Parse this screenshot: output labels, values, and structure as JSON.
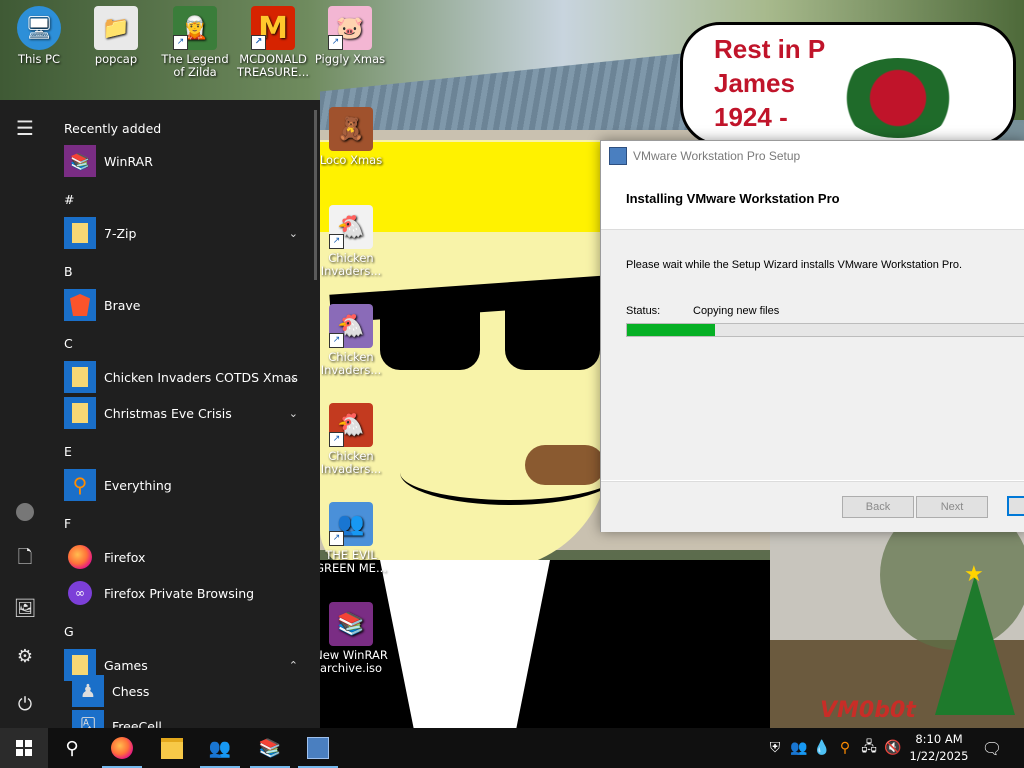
{
  "desktop_icons": [
    {
      "label": "This PC",
      "icon": "computer-icon"
    },
    {
      "label": "popcap",
      "icon": "folder-icon"
    },
    {
      "label": "The Legend of Zilda",
      "icon": "game-icon"
    },
    {
      "label": "MCDONALD TREASURE...",
      "icon": "mcdonalds-icon"
    },
    {
      "label": "Piggly Xmas",
      "icon": "pig-icon"
    },
    {
      "label": "Loco Xmas",
      "icon": "bear-icon"
    },
    {
      "label": "Chicken Invaders...",
      "icon": "chicken-icon"
    },
    {
      "label": "Chicken Invaders...",
      "icon": "chicken-icon"
    },
    {
      "label": "Chicken Invaders...",
      "icon": "chicken-icon"
    },
    {
      "label": "THE EVIL GREEN ME...",
      "icon": "people-icon"
    },
    {
      "label": "New WinRAR archive.iso",
      "icon": "winrar-icon"
    }
  ],
  "wallpaper_sign": {
    "line1": "Rest in P",
    "line2": "James",
    "line3": "1924 -"
  },
  "watermark": "VM0b0t",
  "start_menu": {
    "recently_added_header": "Recently added",
    "sections": {
      "hash": "#",
      "b": "B",
      "c": "C",
      "e": "E",
      "f": "F",
      "g": "G"
    },
    "apps": {
      "winrar": "WinRAR",
      "sevenzip": "7-Zip",
      "brave": "Brave",
      "chicken": "Chicken Invaders COTDS Xmas",
      "christmas": "Christmas Eve Crisis",
      "everything": "Everything",
      "firefox": "Firefox",
      "firefox_private": "Firefox Private Browsing",
      "games": "Games",
      "chess": "Chess",
      "freecell": "FreeCell"
    }
  },
  "installer": {
    "window_title": "VMware Workstation Pro Setup",
    "heading": "Installing VMware Workstation Pro",
    "description": "Please wait while the Setup Wizard installs VMware Workstation Pro.",
    "status_label": "Status:",
    "status_value": "Copying new files",
    "progress_percent": 22,
    "back_label": "Back",
    "next_label": "Next"
  },
  "taskbar": {
    "time": "8:10 AM",
    "date": "1/22/2025",
    "pinned": [
      "search-icon",
      "firefox-icon",
      "file-explorer-icon",
      "people-app-icon",
      "winrar-icon",
      "vmware-setup-icon"
    ]
  },
  "colors": {
    "accent": "#0078d7",
    "progress": "#06b025",
    "start_menu_bg": "#1f1f1f",
    "rip_text": "#c0142a"
  }
}
